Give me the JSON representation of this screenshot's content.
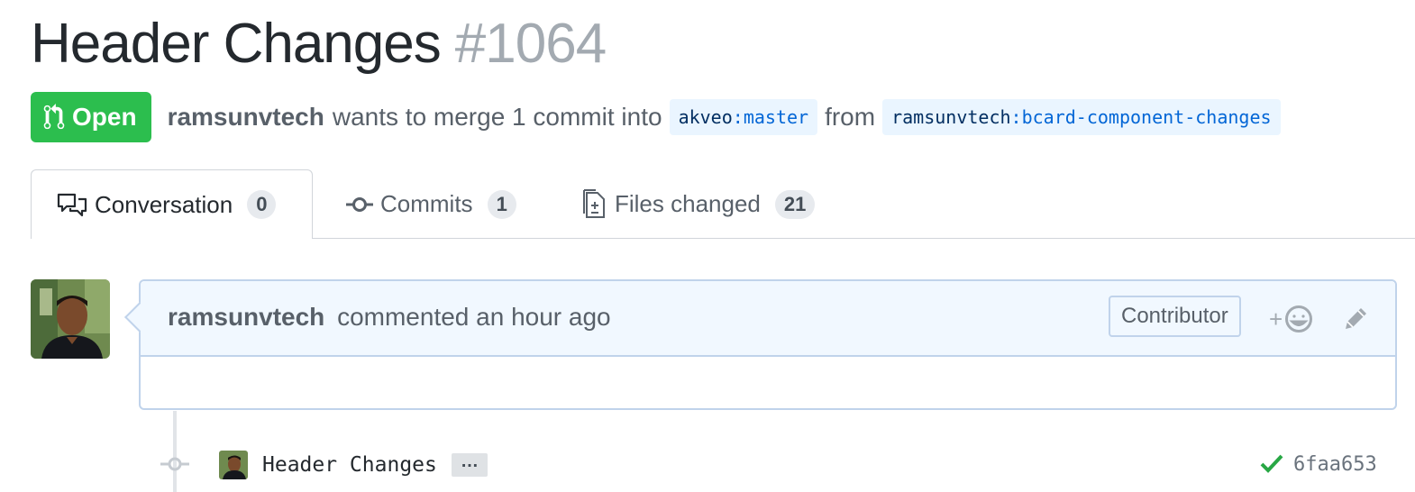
{
  "pr": {
    "title": "Header Changes",
    "number": "#1064",
    "state": "Open",
    "author": "ramsunvtech",
    "merge_text": "wants to merge 1 commit into",
    "base_owner": "akveo",
    "base_branch": "master",
    "from_text": "from",
    "head_owner": "ramsunvtech",
    "head_branch": "bcard-component-changes",
    "colors": {
      "state_open": "#2cbe4e",
      "branch_bg": "#eaf5ff",
      "link": "#0366d6"
    }
  },
  "tabs": [
    {
      "label": "Conversation",
      "count": "0",
      "icon": "comment-discussion-icon",
      "selected": true
    },
    {
      "label": "Commits",
      "count": "1",
      "icon": "git-commit-icon",
      "selected": false
    },
    {
      "label": "Files changed",
      "count": "21",
      "icon": "file-diff-icon",
      "selected": false
    }
  ],
  "comment": {
    "author": "ramsunvtech",
    "action": "commented an hour ago",
    "role": "Contributor",
    "reaction_plus": "+",
    "reaction_icon": "smiley-icon",
    "edit_icon": "pencil-icon",
    "body": ""
  },
  "commit": {
    "message": "Header Changes",
    "expander": "…",
    "status_icon": "check-icon",
    "sha": "6faa653"
  }
}
